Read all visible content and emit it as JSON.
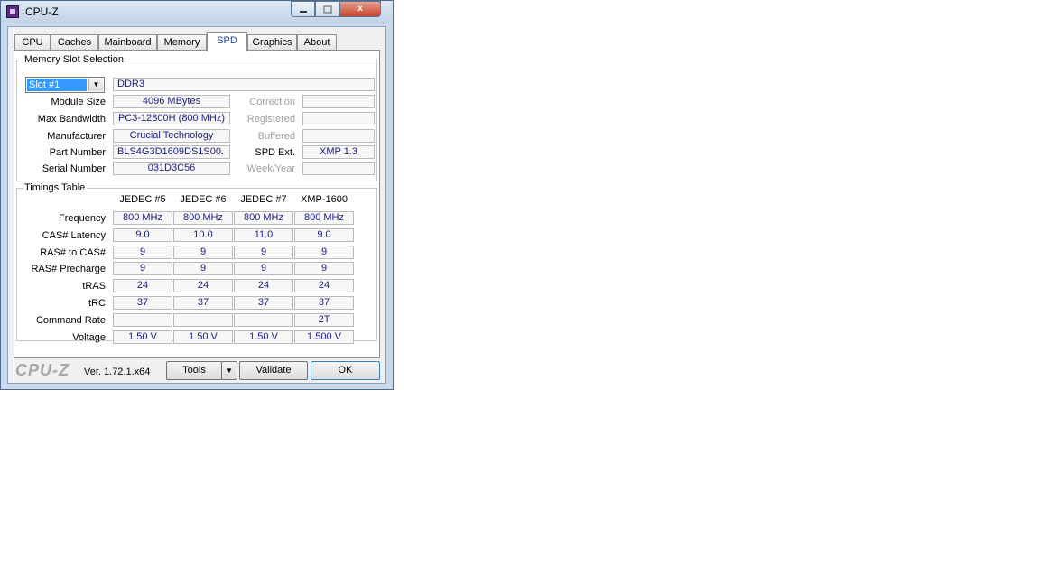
{
  "window": {
    "title": "CPU-Z"
  },
  "tabs": [
    "CPU",
    "Caches",
    "Mainboard",
    "Memory",
    "SPD",
    "Graphics",
    "About"
  ],
  "active_tab": "SPD",
  "slot_section": {
    "title": "Memory Slot Selection",
    "slot_selected": "Slot #1",
    "memory_type": "DDR3",
    "rows": [
      {
        "label": "Module Size",
        "value": "4096 MBytes",
        "side_label": "Correction",
        "side_value": ""
      },
      {
        "label": "Max Bandwidth",
        "value": "PC3-12800H (800 MHz)",
        "side_label": "Registered",
        "side_value": ""
      },
      {
        "label": "Manufacturer",
        "value": "Crucial Technology",
        "side_label": "Buffered",
        "side_value": ""
      },
      {
        "label": "Part Number",
        "value": "BLS4G3D1609DS1S00.",
        "side_label": "SPD Ext.",
        "side_value": "XMP 1.3"
      },
      {
        "label": "Serial Number",
        "value": "031D3C56",
        "side_label": "Week/Year",
        "side_value": ""
      }
    ]
  },
  "timings": {
    "title": "Timings Table",
    "columns": [
      "JEDEC #5",
      "JEDEC #6",
      "JEDEC #7",
      "XMP-1600"
    ],
    "rows": [
      {
        "label": "Frequency",
        "values": [
          "800 MHz",
          "800 MHz",
          "800 MHz",
          "800 MHz"
        ]
      },
      {
        "label": "CAS# Latency",
        "values": [
          "9.0",
          "10.0",
          "11.0",
          "9.0"
        ]
      },
      {
        "label": "RAS# to CAS#",
        "values": [
          "9",
          "9",
          "9",
          "9"
        ]
      },
      {
        "label": "RAS# Precharge",
        "values": [
          "9",
          "9",
          "9",
          "9"
        ]
      },
      {
        "label": "tRAS",
        "values": [
          "24",
          "24",
          "24",
          "24"
        ]
      },
      {
        "label": "tRC",
        "values": [
          "37",
          "37",
          "37",
          "37"
        ]
      },
      {
        "label": "Command Rate",
        "values": [
          "",
          "",
          "",
          "2T"
        ]
      },
      {
        "label": "Voltage",
        "values": [
          "1.50 V",
          "1.50 V",
          "1.50 V",
          "1.500 V"
        ]
      }
    ]
  },
  "footer": {
    "logo": "CPU-Z",
    "version": "Ver. 1.72.1.x64",
    "tools_label": "Tools",
    "validate_label": "Validate",
    "ok_label": "OK"
  },
  "window_buttons": {
    "close_glyph": "x"
  },
  "colors": {
    "value_text": "#1a1a8a",
    "active_tab_text": "#1f3fa8",
    "selection": "#3399ff"
  }
}
